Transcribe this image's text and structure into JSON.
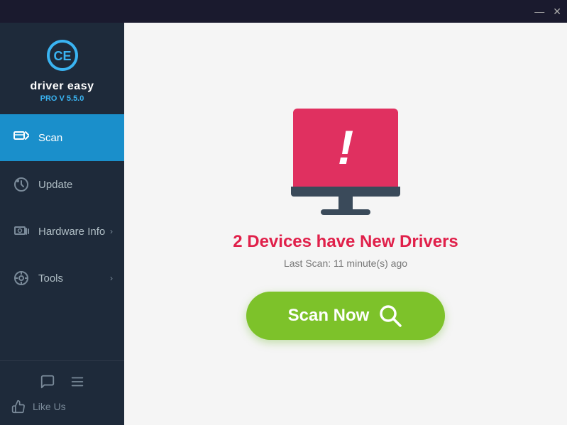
{
  "titlebar": {
    "minimize_label": "—",
    "close_label": "✕"
  },
  "sidebar": {
    "app_name": "driver easy",
    "app_version": "PRO V 5.5.0",
    "nav_items": [
      {
        "id": "scan",
        "label": "Scan",
        "active": true,
        "has_arrow": false
      },
      {
        "id": "update",
        "label": "Update",
        "active": false,
        "has_arrow": false
      },
      {
        "id": "hardware-info",
        "label": "Hardware Info",
        "active": false,
        "has_arrow": true
      },
      {
        "id": "tools",
        "label": "Tools",
        "active": false,
        "has_arrow": true
      }
    ],
    "like_us_label": "Like Us"
  },
  "main": {
    "devices_title": "2 Devices have New Drivers",
    "last_scan_label": "Last Scan: 11 minute(s) ago",
    "scan_now_label": "Scan Now"
  }
}
